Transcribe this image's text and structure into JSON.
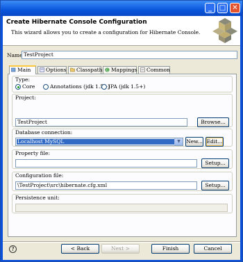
{
  "header": {
    "title": "Create Hibernate Console Configuration",
    "description": "This wizard allows you to create a configuration for Hibernate Console."
  },
  "name": {
    "label": "Name:",
    "value": "TestProject"
  },
  "tabs": [
    {
      "label": "Main",
      "icon": "main-icon",
      "active": true
    },
    {
      "label": "Options",
      "icon": "options-icon"
    },
    {
      "label": "Classpath",
      "icon": "classpath-icon"
    },
    {
      "label": "Mappings",
      "icon": "mappings-icon"
    },
    {
      "label": "Common",
      "icon": "common-icon"
    }
  ],
  "main": {
    "type": {
      "label": "Type:",
      "options": [
        {
          "label": "Core",
          "selected": true
        },
        {
          "label": "Annotations (jdk 1.5+)",
          "selected": false
        },
        {
          "label": "JPA (jdk 1.5+)",
          "selected": false
        }
      ]
    },
    "project": {
      "label": "Project:",
      "value": "TestProject",
      "button": "Browse..."
    },
    "database": {
      "label": "Database connection:",
      "value": "Localhost MySQL",
      "new_button": "New...",
      "edit_button": "Edit..."
    },
    "property_file": {
      "label": "Property file:",
      "value": "",
      "button": "Setup..."
    },
    "config_file": {
      "label": "Configuration file:",
      "value": "\\TestProject\\src\\hibernate.cfg.xml",
      "button": "Setup..."
    },
    "persistence_unit": {
      "label": "Persistence unit:",
      "value": ""
    }
  },
  "footer": {
    "help": "?",
    "back": "< Back",
    "next": "Next >",
    "finish": "Finish",
    "cancel": "Cancel"
  },
  "colors": {
    "title_bar": "#0a56dd",
    "selection": "#316ac5",
    "tab_highlight": "#ffc83c"
  }
}
